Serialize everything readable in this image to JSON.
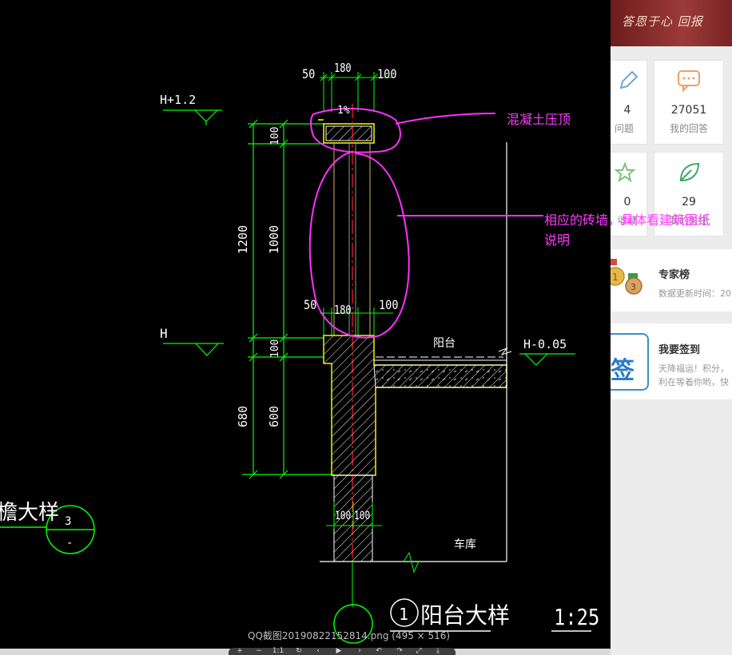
{
  "banner": {
    "slogan": "答恩于心  回报"
  },
  "stats": [
    {
      "value": "4",
      "label": "问题"
    },
    {
      "value": "27051",
      "label": "我的回答"
    },
    {
      "value": "0",
      "label": "收藏"
    },
    {
      "value": "29",
      "label": "我的关注"
    }
  ],
  "ranking": {
    "title": "专家榜",
    "subtitle": "数据更新时间：20"
  },
  "signin": {
    "title": "我要签到",
    "icon_text": "签",
    "desc1": "天降福运！积分，",
    "desc2": "利在等着你哟，快"
  },
  "viewer": {
    "caption": "QQ截图20190822152814.png (495 × 516)",
    "toolbar_icons": [
      "+",
      "−",
      "1:1",
      "↻",
      "‹",
      "▶",
      "›",
      "↶",
      "↷",
      "⤢",
      "⤓"
    ]
  },
  "drawing": {
    "dims_top": [
      "50",
      "180",
      "100"
    ],
    "dims_mid": [
      "50",
      "180",
      "100"
    ],
    "dims_bottom": [
      "100",
      "100"
    ],
    "dims_vertical": [
      "100",
      "1200",
      "1000",
      "100",
      "680",
      "600"
    ],
    "levels": {
      "top": "H+1.2",
      "mid": "H",
      "right": "H-0.05"
    },
    "slope": "1%",
    "room_balcony": "阳台",
    "room_garage": "车库",
    "detail_title": "阳台大样",
    "detail_number": "1",
    "scale": "1:25",
    "left_detail_title": "檐大样",
    "left_circle_top": "3",
    "left_circle_bottom": "-"
  },
  "annotations": {
    "note1": "混凝土压顶",
    "note2_line1": "相应的砖墙，具体看建筑图纸",
    "note2_line2": "说明"
  },
  "colors": {
    "dim_green": "#00ff00",
    "yellow": "#ffff00",
    "magenta": "#ff30ff",
    "white": "#ffffff",
    "red": "#ff2020"
  }
}
